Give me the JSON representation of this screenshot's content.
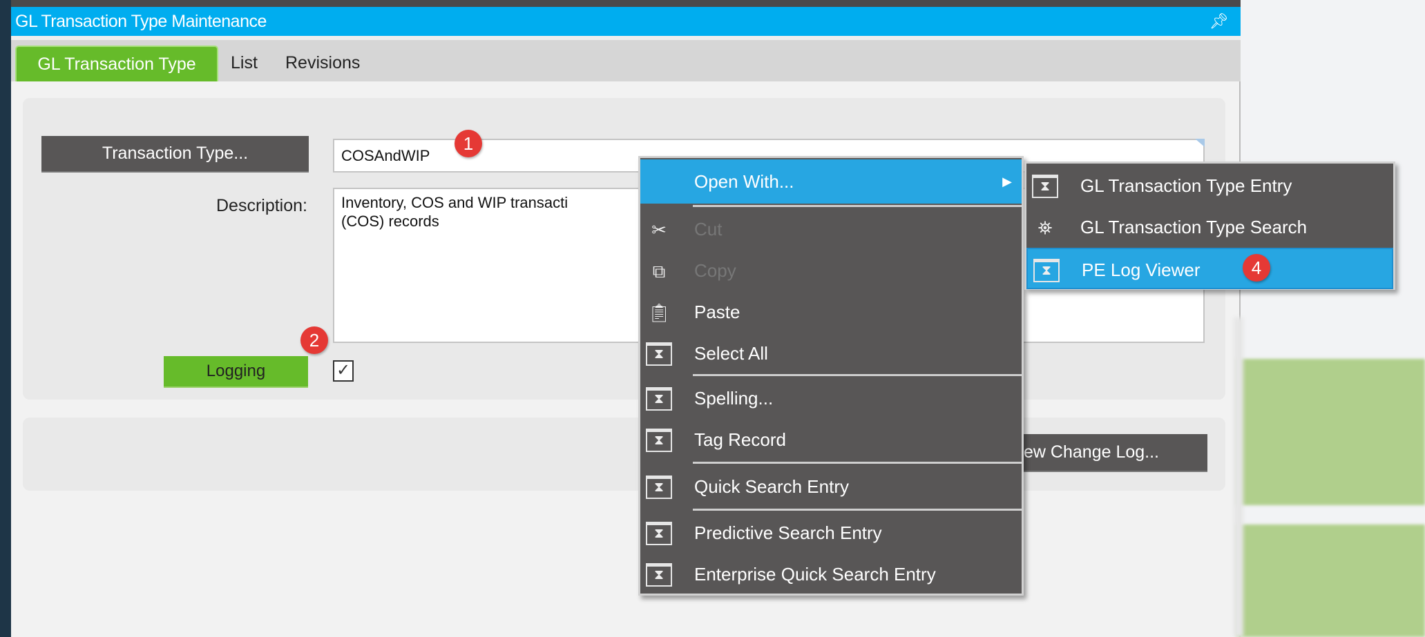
{
  "window": {
    "title": "GL Transaction Type Maintenance",
    "pin_icon": "pin-icon"
  },
  "tabs": [
    {
      "label": "GL Transaction Type",
      "active": true
    },
    {
      "label": "List"
    },
    {
      "label": "Revisions"
    }
  ],
  "form": {
    "transaction_type_button": "Transaction Type...",
    "transaction_type_value": "COSAndWIP",
    "description_label": "Description:",
    "description_value": "Inventory, COS and WIP transacti\n(COS) records",
    "logging_button": "Logging",
    "logging_checked": true,
    "change_log_button": "View Change Log..."
  },
  "context_menu": {
    "items": [
      {
        "label": "Open With...",
        "icon": "none",
        "highlighted": true,
        "submenu": true
      },
      {
        "label": "Cut",
        "icon": "scissors-icon",
        "disabled": true
      },
      {
        "label": "Copy",
        "icon": "copy-icon",
        "disabled": true
      },
      {
        "label": "Paste",
        "icon": "paste-icon"
      },
      {
        "label": "Select All",
        "icon": "hourglass-window-icon"
      },
      {
        "label": "Spelling...",
        "icon": "hourglass-window-icon"
      },
      {
        "label": "Tag Record",
        "icon": "hourglass-window-icon"
      },
      {
        "label": "Quick Search Entry",
        "icon": "hourglass-window-icon"
      },
      {
        "label": "Predictive Search Entry",
        "icon": "hourglass-window-icon"
      },
      {
        "label": "Enterprise Quick Search Entry",
        "icon": "hourglass-window-icon"
      }
    ]
  },
  "submenu": {
    "items": [
      {
        "label": "GL Transaction Type Entry",
        "icon": "hourglass-window-icon"
      },
      {
        "label": "GL Transaction Type Search",
        "icon": "binoculars-icon"
      },
      {
        "label": "PE Log Viewer",
        "icon": "hourglass-window-icon",
        "highlighted": true
      }
    ]
  },
  "badges": [
    "1",
    "2",
    "4"
  ],
  "colors": {
    "titlebar": "#00adef",
    "tab_active": "#66bb2a",
    "menu_bg": "#585656",
    "highlight": "#27a6e2",
    "badge": "#e53935"
  }
}
